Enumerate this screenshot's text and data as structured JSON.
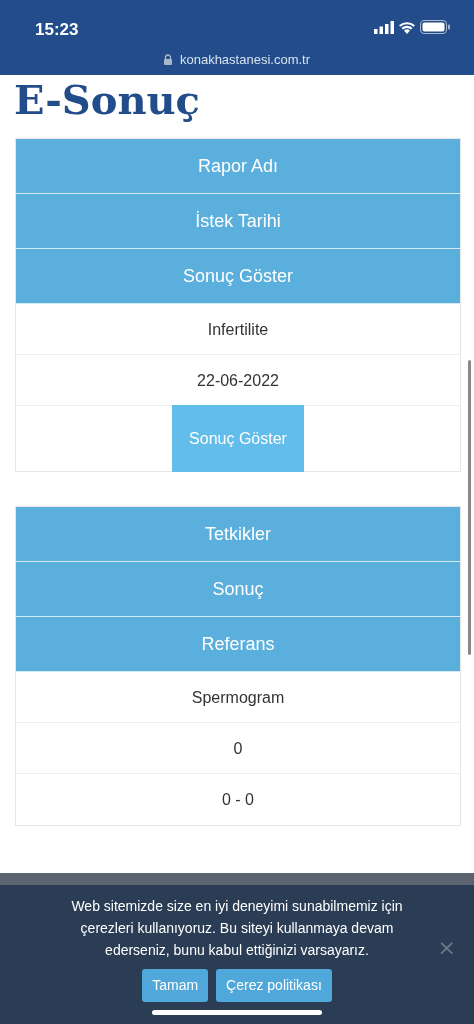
{
  "status_bar": {
    "time": "15:23"
  },
  "address_bar": {
    "url": "konakhastanesi.com.tr"
  },
  "page_title": "E-Sonuç",
  "tables": [
    {
      "headers": [
        "Rapor Adı",
        "İstek Tarihi",
        "Sonuç Göster"
      ],
      "cells": [
        {
          "kind": "text",
          "text": "Infertilite"
        },
        {
          "kind": "text",
          "text": "22-06-2022"
        },
        {
          "kind": "button",
          "text": "Sonuç Göster"
        }
      ]
    },
    {
      "headers": [
        "Tetkikler",
        "Sonuç",
        "Referans"
      ],
      "cells": [
        {
          "kind": "text",
          "text": "Spermogram"
        },
        {
          "kind": "text",
          "text": "0"
        },
        {
          "kind": "text",
          "text": "0 - 0"
        }
      ]
    }
  ],
  "cookie_banner": {
    "message": "Web sitemizde size en iyi deneyimi sunabilmemiz için çerezleri kullanıyoruz. Bu siteyi kullanmaya devam ederseniz, bunu kabul ettiğinizi varsayarız.",
    "buttons": [
      "Tamam",
      "Çerez politikası"
    ],
    "close": "×"
  }
}
